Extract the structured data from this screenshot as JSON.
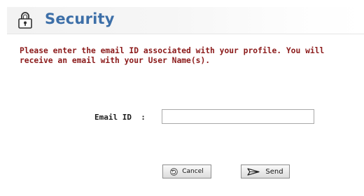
{
  "header": {
    "title": "Security",
    "icon": "lock-icon"
  },
  "message": "Please enter the email ID associated with your profile. You will\nreceive an email with your User Name(s).",
  "form": {
    "email_label": "Email ID  :",
    "email_value": "",
    "email_placeholder": ""
  },
  "buttons": {
    "cancel_label": "Cancel",
    "cancel_icon": "undo-icon",
    "send_label": "Send",
    "send_icon": "send-arrow-icon"
  },
  "colors": {
    "title": "#3d6fa8",
    "message": "#8b1a1a"
  }
}
